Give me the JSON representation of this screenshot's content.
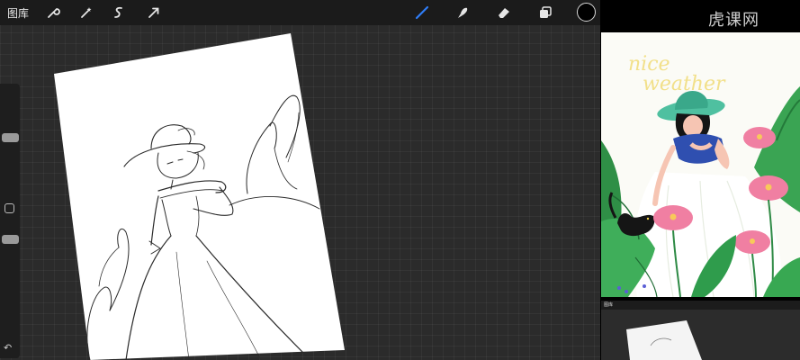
{
  "app": {
    "gallery_label": "图库",
    "tools_left": [
      {
        "name": "wrench-icon"
      },
      {
        "name": "magic-wand-icon"
      },
      {
        "name": "selection-icon"
      },
      {
        "name": "transform-arrow-icon"
      }
    ],
    "tools_right": [
      {
        "name": "brush-icon"
      },
      {
        "name": "smudge-icon"
      },
      {
        "name": "eraser-icon"
      },
      {
        "name": "layers-icon"
      }
    ],
    "active_color": "#000000",
    "accent_color": "#2f7df6"
  },
  "sidebar": {
    "undo_icon": "undo-icon"
  },
  "illustration": {
    "title_text": "nice weather"
  },
  "thumbnail": {
    "label": "图库"
  },
  "watermark": {
    "text": "虎课网"
  }
}
